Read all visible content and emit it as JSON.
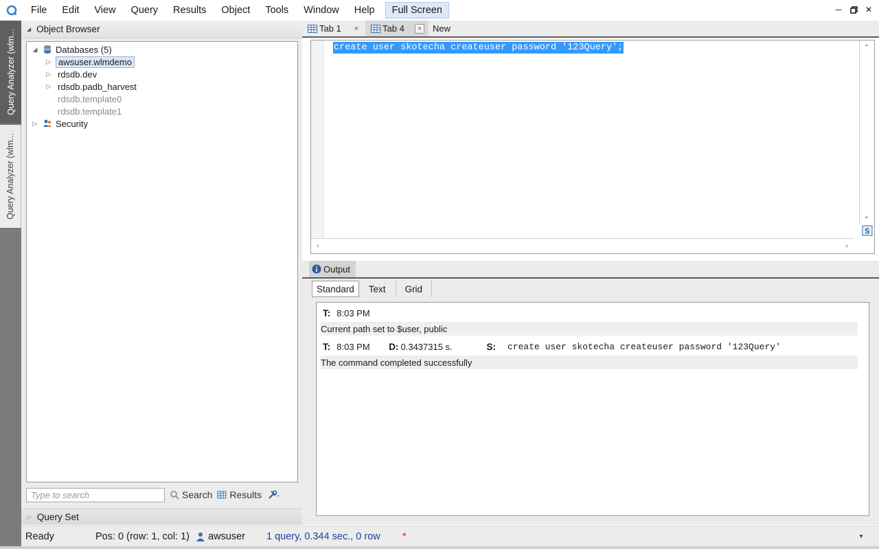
{
  "menubar": {
    "items": [
      "File",
      "Edit",
      "View",
      "Query",
      "Results",
      "Object",
      "Tools",
      "Window",
      "Help"
    ],
    "fullscreen_label": "Full Screen",
    "window_controls": [
      "minimize-icon",
      "restore-icon",
      "close-icon"
    ]
  },
  "side_strip": {
    "tabs": [
      "Query Analyzer (wlm...",
      "Query Analyzer (wlm..."
    ]
  },
  "object_browser": {
    "title": "Object Browser",
    "tree": [
      {
        "label": "Databases (5)",
        "expanded": true,
        "icon": "databases-icon"
      },
      {
        "label": "awsuser.wlmdemo",
        "selected": true
      },
      {
        "label": "rdsdb.dev"
      },
      {
        "label": "rdsdb.padb_harvest"
      },
      {
        "label": "rdsdb.template0",
        "disabled": true
      },
      {
        "label": "rdsdb.template1",
        "disabled": true
      },
      {
        "label": "Security",
        "icon": "users-icon"
      }
    ],
    "search_placeholder": "Type to search",
    "search_label": "Search",
    "results_label": "Results"
  },
  "query_set": {
    "title": "Query Set"
  },
  "editor_tabs": {
    "tab1": "Tab 1",
    "tab4": "Tab 4",
    "new": "New",
    "close_glyph": "×"
  },
  "editor": {
    "code": "create user skotecha createuser password '123Query';"
  },
  "output": {
    "title": "Output",
    "tabs": [
      "Standard",
      "Text",
      "Grid"
    ],
    "active_tab": "Standard",
    "rows": {
      "r1_t_label": "T:",
      "r1_time": "8:03 PM",
      "r2_msg": "Current path set to $user, public",
      "r3_t_label": "T:",
      "r3_time": "8:03 PM",
      "r3_d_label": "D:",
      "r3_duration": "0.3437315 s.",
      "r3_s_label": "S:",
      "r3_statement": "create user skotecha createuser password '123Query'",
      "r4_msg": "The command completed successfully"
    }
  },
  "statusbar": {
    "ready": "Ready",
    "position": "Pos: 0 (row: 1, col: 1)",
    "user": "awsuser",
    "query_info": "1 query, 0.344 sec., 0 row",
    "modified_marker": "*"
  },
  "colors": {
    "selection": "#3399ff",
    "accent_blue": "#1f3fa0",
    "modified_red": "#d81e1e"
  }
}
